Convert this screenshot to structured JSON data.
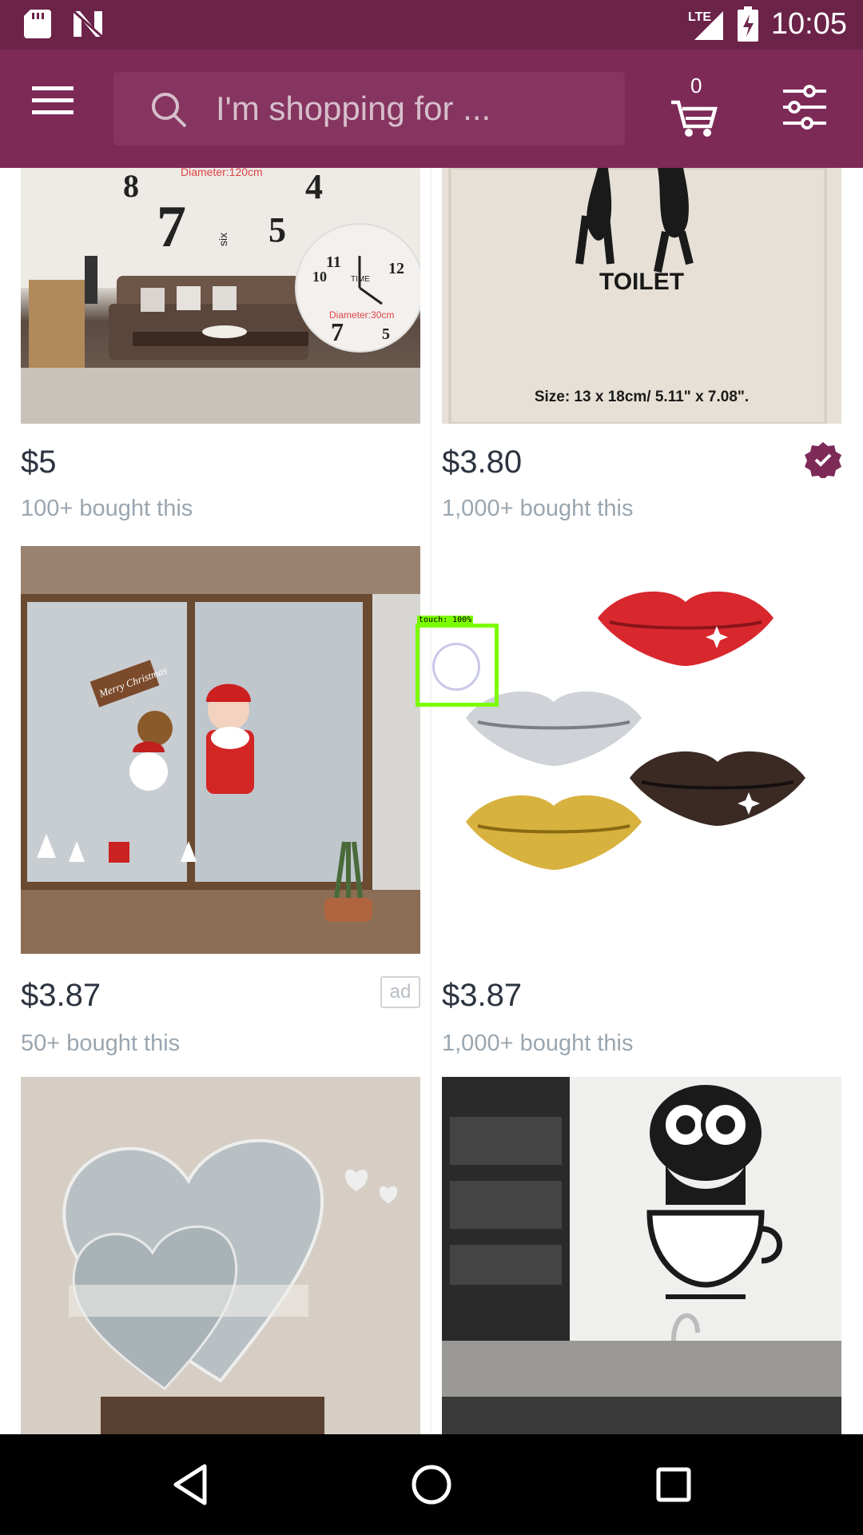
{
  "status_bar": {
    "time": "10:05",
    "network": "LTE",
    "icons": [
      "sd-card-icon",
      "n-notification-icon",
      "signal-icon",
      "battery-charging-icon"
    ]
  },
  "header": {
    "search_placeholder": "I'm shopping for ...",
    "cart_count": "0",
    "icons": [
      "menu-icon",
      "search-icon",
      "cart-icon",
      "filter-icon"
    ]
  },
  "products": [
    {
      "name": "wall-clock",
      "price": "$5",
      "sold": "100+ bought this",
      "image_text": [
        "8",
        "7",
        "six",
        "5",
        "4",
        "Diameter:120cm",
        "11",
        "12",
        "10",
        "TIME",
        "7",
        "5",
        "Diameter:30cm"
      ]
    },
    {
      "name": "toilet-sign",
      "price": "$3.80",
      "sold": "1,000+ bought this",
      "verified": true,
      "image_text": [
        "TOILET",
        "Size: 13 x 18cm/ 5.11\" x 7.08\"."
      ]
    },
    {
      "name": "christmas-window-sticker",
      "price": "$3.87",
      "sold": "50+ bought this",
      "ad_label": "ad",
      "image_text": [
        "Merry Christmas"
      ]
    },
    {
      "name": "lips-mirror-sticker",
      "price": "$3.87",
      "sold": "1,000+ bought this"
    },
    {
      "name": "heart-mirror-sticker"
    },
    {
      "name": "owl-cup-decal"
    }
  ],
  "touch_indicator": {
    "label": "touch: 100%"
  },
  "colors": {
    "status_bar": "#6b2348",
    "app_bar": "#7d2a57",
    "search_bg": "#853560",
    "price_text": "#2c3440",
    "sold_text": "#9aa6b0",
    "verified": "#7d2a57"
  }
}
